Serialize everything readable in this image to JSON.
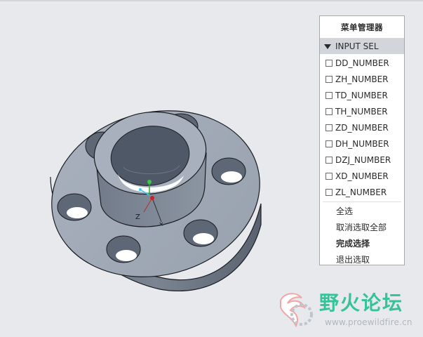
{
  "menu": {
    "title": "菜单管理器",
    "header": "INPUT SEL",
    "items": [
      "DD_NUMBER",
      "ZH_NUMBER",
      "TD_NUMBER",
      "TH_NUMBER",
      "ZD_NUMBER",
      "DH_NUMBER",
      "DZJ_NUMBER",
      "XD_NUMBER",
      "ZL_NUMBER"
    ],
    "commands": [
      "全选",
      "取消选取全部",
      "完成选择",
      "退出选取"
    ]
  },
  "model": {
    "axis_label_z": "Z"
  },
  "watermark": {
    "title": "野火论坛",
    "url": "www.proewildfire.cn"
  },
  "colors": {
    "accent_green": "#37c39a",
    "part_gray": "#8c96a4"
  }
}
